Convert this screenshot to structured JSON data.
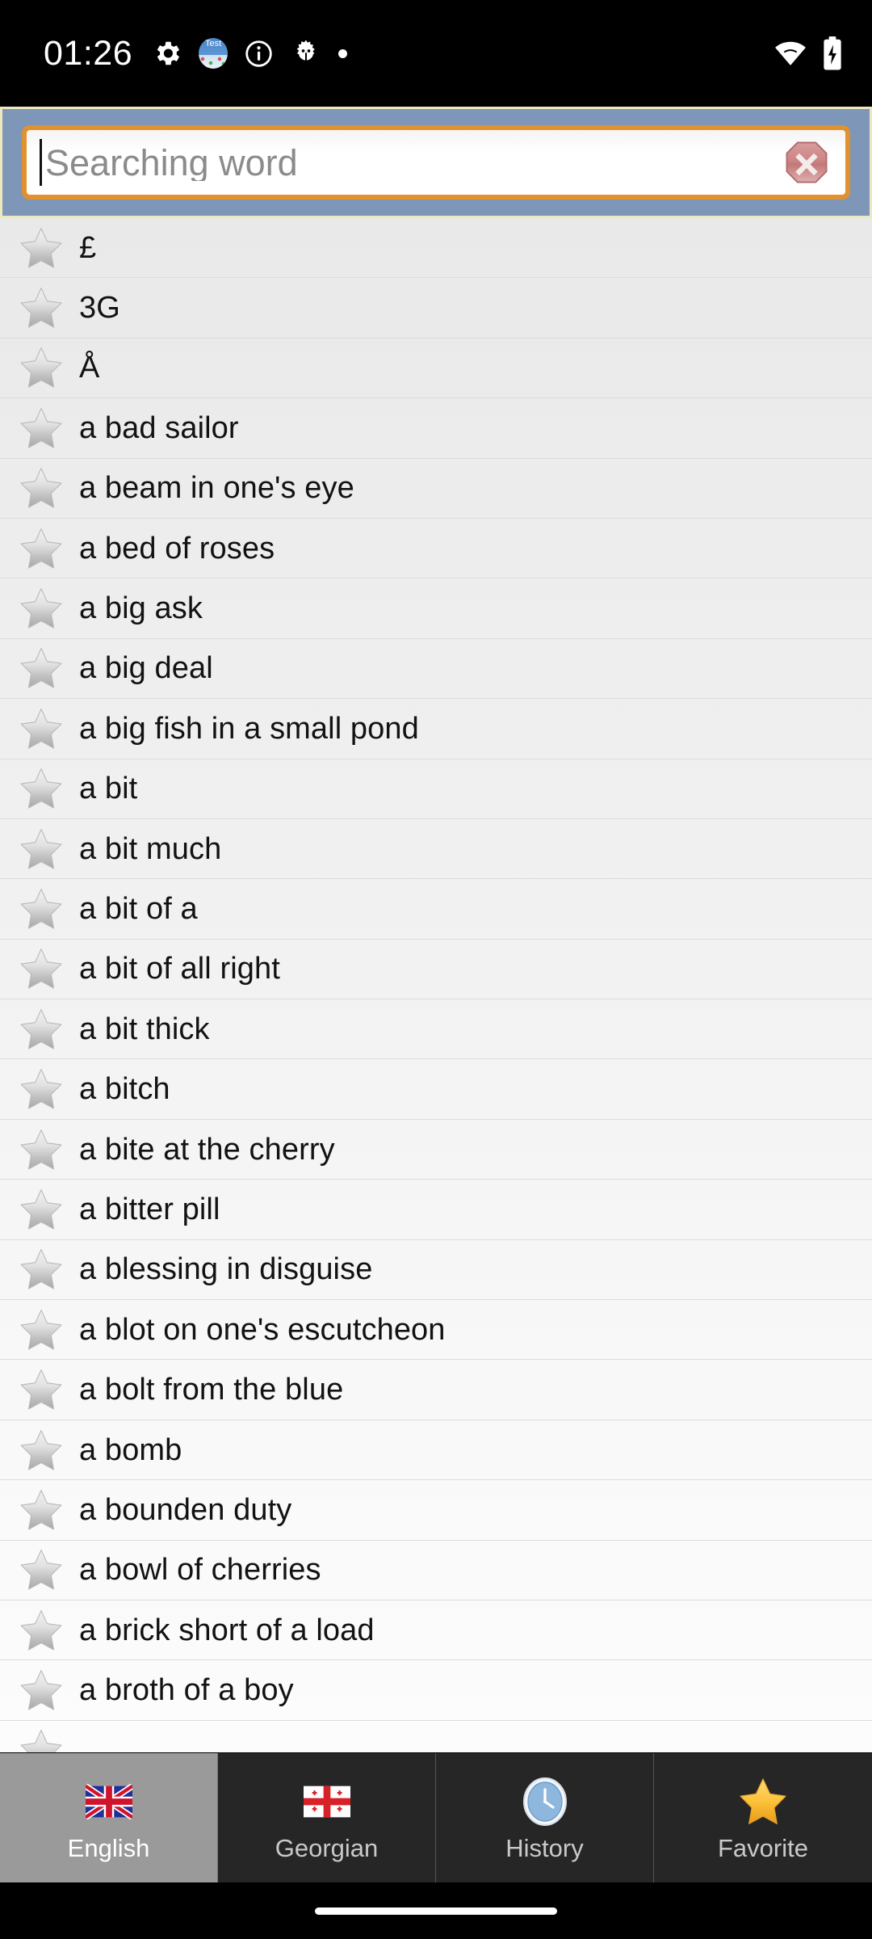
{
  "status_bar": {
    "time": "01:26",
    "left_icons": [
      {
        "name": "gear-icon",
        "label": "settings"
      },
      {
        "name": "test-app-icon",
        "label": "Test"
      },
      {
        "name": "info-icon",
        "label": "info"
      },
      {
        "name": "bug-icon",
        "label": "bug"
      },
      {
        "name": "dot-icon",
        "label": "dot"
      }
    ],
    "right_icons": [
      {
        "name": "wifi-icon",
        "label": "wifi"
      },
      {
        "name": "battery-charging-icon",
        "label": "battery charging"
      }
    ]
  },
  "search": {
    "placeholder": "Searching word",
    "value": "",
    "clear_label": "Clear",
    "border_color": "#e2912f",
    "header_bg": "#7e96b7",
    "clear_color": "#c87b7b"
  },
  "list": {
    "items": [
      {
        "word": "£",
        "favorite": false
      },
      {
        "word": "3G",
        "favorite": false
      },
      {
        "word": "Å",
        "favorite": false
      },
      {
        "word": "a bad sailor",
        "favorite": false
      },
      {
        "word": "a beam in one's eye",
        "favorite": false
      },
      {
        "word": "a bed of roses",
        "favorite": false
      },
      {
        "word": "a big ask",
        "favorite": false
      },
      {
        "word": "a big deal",
        "favorite": false
      },
      {
        "word": "a big fish in a small pond",
        "favorite": false
      },
      {
        "word": "a bit",
        "favorite": false
      },
      {
        "word": "a bit much",
        "favorite": false
      },
      {
        "word": "a bit of a",
        "favorite": false
      },
      {
        "word": "a bit of all right",
        "favorite": false
      },
      {
        "word": "a bit thick",
        "favorite": false
      },
      {
        "word": "a bitch",
        "favorite": false
      },
      {
        "word": "a bite at the cherry",
        "favorite": false
      },
      {
        "word": "a bitter pill",
        "favorite": false
      },
      {
        "word": "a blessing in disguise",
        "favorite": false
      },
      {
        "word": "a blot on one's escutcheon",
        "favorite": false
      },
      {
        "word": "a bolt from the blue",
        "favorite": false
      },
      {
        "word": "a bomb",
        "favorite": false
      },
      {
        "word": "a bounden duty",
        "favorite": false
      },
      {
        "word": "a bowl of cherries",
        "favorite": false
      },
      {
        "word": "a brick short of a load",
        "favorite": false
      },
      {
        "word": "a broth of a boy",
        "favorite": false
      },
      {
        "word": "",
        "favorite": false
      }
    ]
  },
  "tabs": [
    {
      "label": "English",
      "icon": "uk-flag-icon",
      "active": true
    },
    {
      "label": "Georgian",
      "icon": "georgia-flag-icon",
      "active": false
    },
    {
      "label": "History",
      "icon": "clock-icon",
      "active": false
    },
    {
      "label": "Favorite",
      "icon": "star-icon",
      "active": false
    }
  ]
}
